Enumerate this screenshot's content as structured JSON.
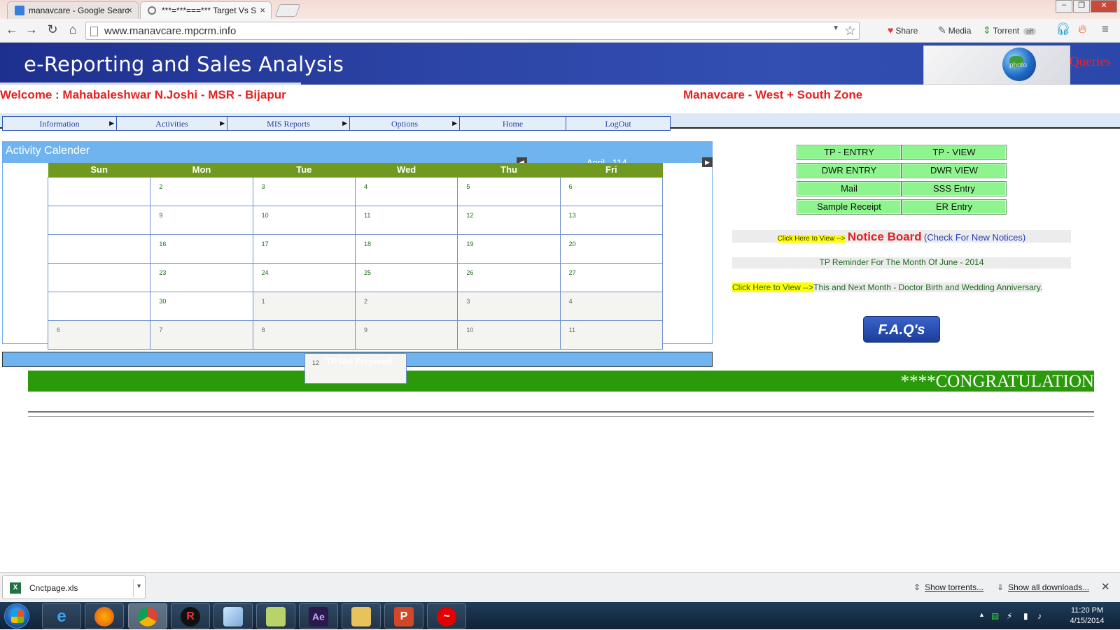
{
  "browser": {
    "tabs": [
      {
        "title": "manavcare - Google Searc",
        "active": false
      },
      {
        "title": "***=***===*** Target Vs S",
        "active": true
      }
    ],
    "url": "www.manavcare.mpcrm.info",
    "extensions": {
      "share": "Share",
      "media": "Media",
      "torrent": "Torrent",
      "off": "off"
    }
  },
  "header": {
    "title": "e-Reporting and Sales Analysis",
    "queries": "Queries",
    "logo_watermark": "photo"
  },
  "welcome": "Welcome : Mahabaleshwar N.Joshi - MSR - Bijapur",
  "zone": "Manavcare - West + South Zone",
  "menu": [
    {
      "label": "Information",
      "submenu": true
    },
    {
      "label": "Activities",
      "submenu": true
    },
    {
      "label": "MIS Reports",
      "submenu": true
    },
    {
      "label": "Options",
      "submenu": true
    },
    {
      "label": "Home",
      "submenu": false
    },
    {
      "label": "LogOut",
      "submenu": false
    }
  ],
  "calendar": {
    "title": "Activity Calender",
    "month": "April , 114",
    "days": [
      "Sun",
      "Mon",
      "Tue",
      "Wed",
      "Thu",
      "Fri"
    ],
    "weeks": [
      [
        "",
        "2",
        "3",
        "4",
        "5",
        "6"
      ],
      [
        "",
        "9",
        "10",
        "11",
        "12",
        "13"
      ],
      [
        "",
        "16",
        "17",
        "18",
        "19",
        "20"
      ],
      [
        "",
        "23",
        "24",
        "25",
        "26",
        "27"
      ],
      [
        "",
        "30",
        "1",
        "2",
        "3",
        "4"
      ],
      [
        "6",
        "7",
        "8",
        "9",
        "10",
        "11"
      ]
    ],
    "popup_day": "12",
    "popup_note": "TP Not Prepared"
  },
  "actions": [
    {
      "label": "TP - ENTRY"
    },
    {
      "label": "TP - VIEW"
    },
    {
      "label": "DWR ENTRY"
    },
    {
      "label": "DWR VIEW"
    },
    {
      "label": "Mail"
    },
    {
      "label": "SSS Entry"
    },
    {
      "label": "Sample Receipt"
    },
    {
      "label": "ER Entry"
    }
  ],
  "notices": {
    "click_small": "Click Here to View -->",
    "notice_board": "Notice Board",
    "check_new": "(Check For New Notices)",
    "tp_reminder": "TP Reminder For The Month Of June - 2014",
    "click_view": "Click Here to View -->",
    "birthday": "This and Next Month - Doctor Birth and Wedding Anniversary."
  },
  "faq": "F.A.Q's",
  "congratulation": "****CONGRATULATION",
  "downloads": {
    "file": "Cnctpage.xls",
    "show_torrents": "Show torrents...",
    "show_all": "Show all downloads..."
  },
  "taskbar": {
    "time": "11:20 PM",
    "date": "4/15/2014"
  },
  "colors": {
    "banner": "#2c45a6",
    "calendar_header": "#6fb4ee",
    "day_header": "#6f9a1f",
    "action_button": "#8ef58e",
    "congrats": "#2a9a0a",
    "alert_red": "#e61f1f"
  }
}
